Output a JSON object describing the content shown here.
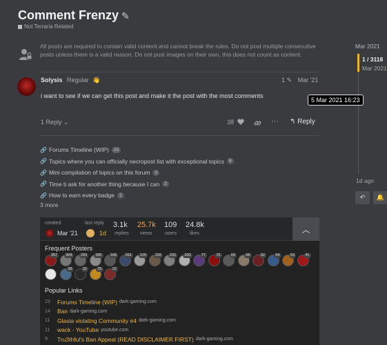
{
  "topic": {
    "title": "Comment Frenzy",
    "category": "Not Terraria Related"
  },
  "notice": "All posts are required to contain valid content and cannot break the rules. Do not post multiple consecutive posts unless there is a valid reason. Do not post images on their own, this does not count as content.",
  "post": {
    "author": "Solysis",
    "rank": "Regular",
    "wave": "👋",
    "edit_count": "1",
    "date": "Mar '21",
    "body": "i want to see if we can get this post and make it the post with the most comments",
    "replies_label": "1 Reply",
    "likes": "38",
    "reply_label": "Reply"
  },
  "tooltip": "5 Mar 2021 16:23",
  "linked_topics": [
    {
      "title": "Forums Timeline (WIP)",
      "count": "23"
    },
    {
      "title": "Topics where you can officially necropost list with exceptional topics",
      "count": "8"
    },
    {
      "title": "Mini compilation of topics on this forum",
      "count": "3"
    },
    {
      "title": "Time ti ask for another thing because I can",
      "count": "2"
    },
    {
      "title": "How to earn every badge",
      "count": "1"
    }
  ],
  "more_label": "3 more",
  "summary": {
    "created_label": "created",
    "created_date": "Mar '21",
    "last_reply_label": "last reply",
    "last_reply_date": "1d",
    "replies": "3.1k",
    "replies_label": "replies",
    "views": "25.7k",
    "views_label": "views",
    "users": "109",
    "users_label": "users",
    "likes": "24.8k",
    "likes_label": "likes"
  },
  "frequent_posters_title": "Frequent Posters",
  "frequent_posters": [
    {
      "count": "357",
      "color": "#8a1a1a"
    },
    {
      "count": "304",
      "color": "#777777"
    },
    {
      "count": "293",
      "color": "#666666"
    },
    {
      "count": "285",
      "color": "#8b8b8b"
    },
    {
      "count": "168",
      "color": "#555555"
    },
    {
      "count": "163",
      "color": "#3b4a6b"
    },
    {
      "count": "120",
      "color": "#9a9a9a"
    },
    {
      "count": "118",
      "color": "#6a5a4a"
    },
    {
      "count": "102",
      "color": "#7f7f7f"
    },
    {
      "count": "100",
      "color": "#b0b0b0"
    },
    {
      "count": "77",
      "color": "#5a3a7a"
    },
    {
      "count": "70",
      "color": "#8a1010"
    },
    {
      "count": "69",
      "color": "#5a5a5a"
    },
    {
      "count": "68",
      "color": "#8a7a6a"
    },
    {
      "count": "62",
      "color": "#6a2020"
    },
    {
      "count": "54",
      "color": "#3a5a8a"
    },
    {
      "count": "53",
      "color": "#a06020"
    },
    {
      "count": "41",
      "color": "#a01818"
    },
    {
      "count": "",
      "color": "#e8e8e8"
    },
    {
      "count": "38",
      "color": "#4a6a8a"
    },
    {
      "count": "32",
      "color": "#2a2a2a"
    },
    {
      "count": "25",
      "color": "#c08a20"
    },
    {
      "count": "22",
      "color": "#7a2a2a"
    }
  ],
  "popular_links_title": "Popular Links",
  "popular_links": [
    {
      "count": "23",
      "title": "Forums Timeline (WIP)",
      "domain": "dark-gaming.com"
    },
    {
      "count": "14",
      "title": "Ban",
      "domain": "dark-gaming.com"
    },
    {
      "count": "11",
      "title": "Glasia violating Community #4",
      "domain": "dark-gaming.com"
    },
    {
      "count": "11",
      "title": "wack - YouTube",
      "domain": "youtube.com"
    },
    {
      "count": "9",
      "title": "Tru3thful's Ban Appeal (READ DISCLAIMER FIRST)",
      "domain": "dark-gaming.com"
    }
  ],
  "timeline": {
    "start_date": "Mar 2021",
    "position": "1 / 3118",
    "current_month": "Mar 2021",
    "end_label": "1d ago"
  },
  "icons": {
    "edit": "pencil-icon",
    "heart": "heart-icon",
    "link": "link-icon",
    "more": "ellipsis-icon",
    "reply": "reply-icon",
    "collapse": "chevron-up-icon",
    "notify": "bell-icon"
  }
}
